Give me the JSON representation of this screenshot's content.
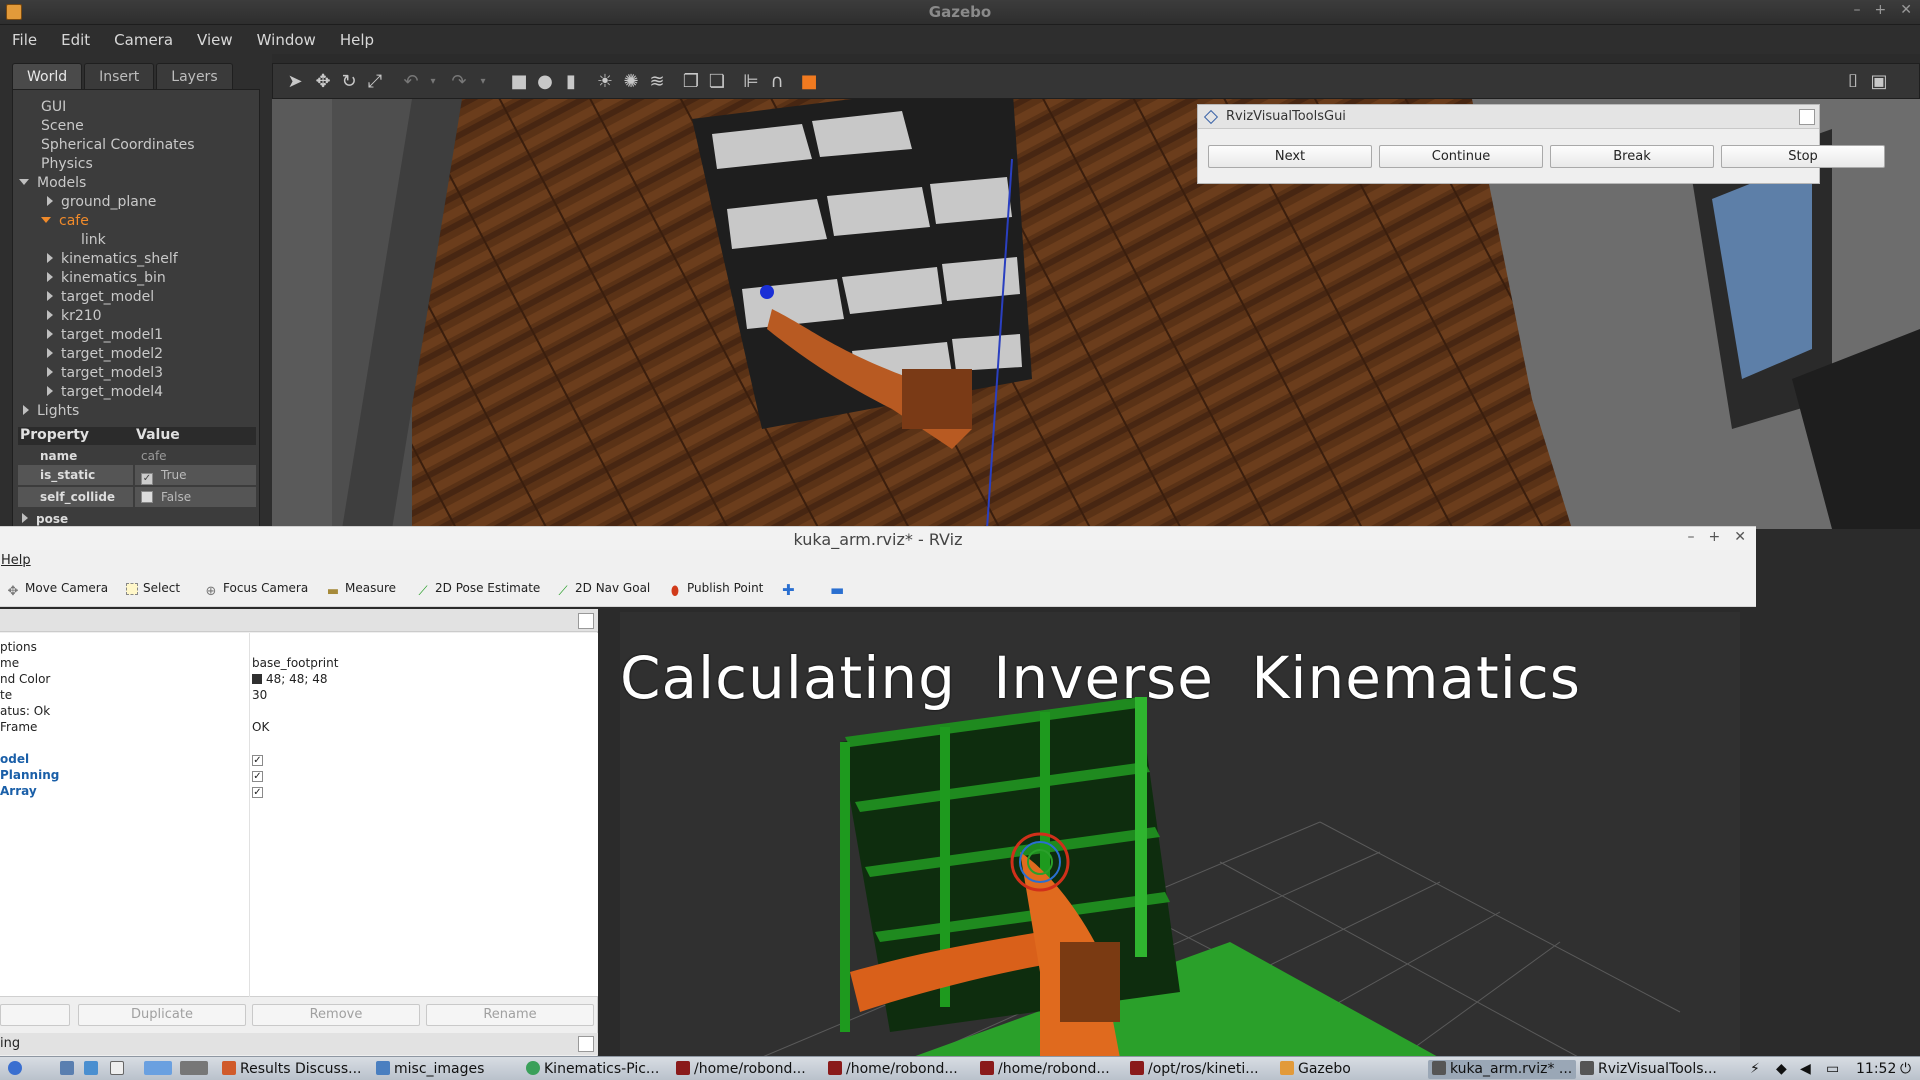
{
  "gazebo": {
    "title": "Gazebo",
    "menu": [
      {
        "label": "File"
      },
      {
        "label": "Edit"
      },
      {
        "label": "Camera"
      },
      {
        "label": "View"
      },
      {
        "label": "Window"
      },
      {
        "label": "Help"
      }
    ],
    "tabs": [
      "World",
      "Insert",
      "Layers"
    ],
    "tree": {
      "gui": "GUI",
      "scene": "Scene",
      "spherical": "Spherical Coordinates",
      "physics": "Physics",
      "models": "Models",
      "ground_plane": "ground_plane",
      "cafe": "cafe",
      "link": "link",
      "kinematics_shelf": "kinematics_shelf",
      "kinematics_bin": "kinematics_bin",
      "target_model": "target_model",
      "kr210": "kr210",
      "target_model1": "target_model1",
      "target_model2": "target_model2",
      "target_model3": "target_model3",
      "target_model4": "target_model4",
      "lights": "Lights"
    },
    "properties": {
      "header_property": "Property",
      "header_value": "Value",
      "name_key": "name",
      "name_value": "cafe",
      "is_static_key": "is_static",
      "is_static_value": "True",
      "self_collide_key": "self_collide",
      "self_collide_value": "False",
      "pose_key": "pose"
    },
    "toolbar_icons": [
      "select-icon",
      "translate-icon",
      "rotate-icon",
      "scale-icon",
      "undo-icon",
      "redo-icon",
      "box-icon",
      "sphere-icon",
      "cylinder-icon",
      "point-light-icon",
      "spot-light-icon",
      "directional-light-icon",
      "copy-icon",
      "paste-icon",
      "align-icon",
      "snap-icon",
      "view-angle-icon",
      "screenshot-icon",
      "record-icon"
    ]
  },
  "rviz_visual_tools": {
    "title": "RvizVisualToolsGui",
    "buttons": {
      "next": "Next",
      "continue": "Continue",
      "break": "Break",
      "stop": "Stop"
    }
  },
  "rviz": {
    "title": "kuka_arm.rviz* - RViz",
    "menu_help": "Help",
    "tools": {
      "move_camera": "Move Camera",
      "select": "Select",
      "focus_camera": "Focus Camera",
      "measure": "Measure",
      "pose_estimate": "2D Pose Estimate",
      "nav_goal": "2D Nav Goal",
      "publish_point": "Publish Point"
    },
    "displays": {
      "options": "ptions",
      "fixed_frame_label": "me",
      "fixed_frame_value": "base_footprint",
      "bg_label": "nd Color",
      "bg_value": "48; 48; 48",
      "rate_label": "te",
      "rate_value": "30",
      "status_label": "atus: Ok",
      "frame_label": " Frame",
      "frame_value": "OK",
      "robot_model": "odel",
      "planning": "Planning",
      "marker_array": "Array"
    },
    "buttons": {
      "duplicate": "Duplicate",
      "remove": "Remove",
      "rename": "Rename"
    },
    "bottom_panel": "ing",
    "overlay_text": "Calculating Inverse Kinematics",
    "background_color": "#303030"
  },
  "taskbar": {
    "items": {
      "results": "Results Discuss...",
      "misc_images": "misc_images",
      "kinematics": "Kinematics-Pic...",
      "term1": "/home/robond...",
      "term2": "/home/robond...",
      "term3": "/home/robond...",
      "opt_ros": "/opt/ros/kineti...",
      "gazebo": "Gazebo",
      "rviz": "kuka_arm.rviz* ...",
      "rvt": "RvizVisualTools..."
    },
    "clock": "11:52"
  }
}
